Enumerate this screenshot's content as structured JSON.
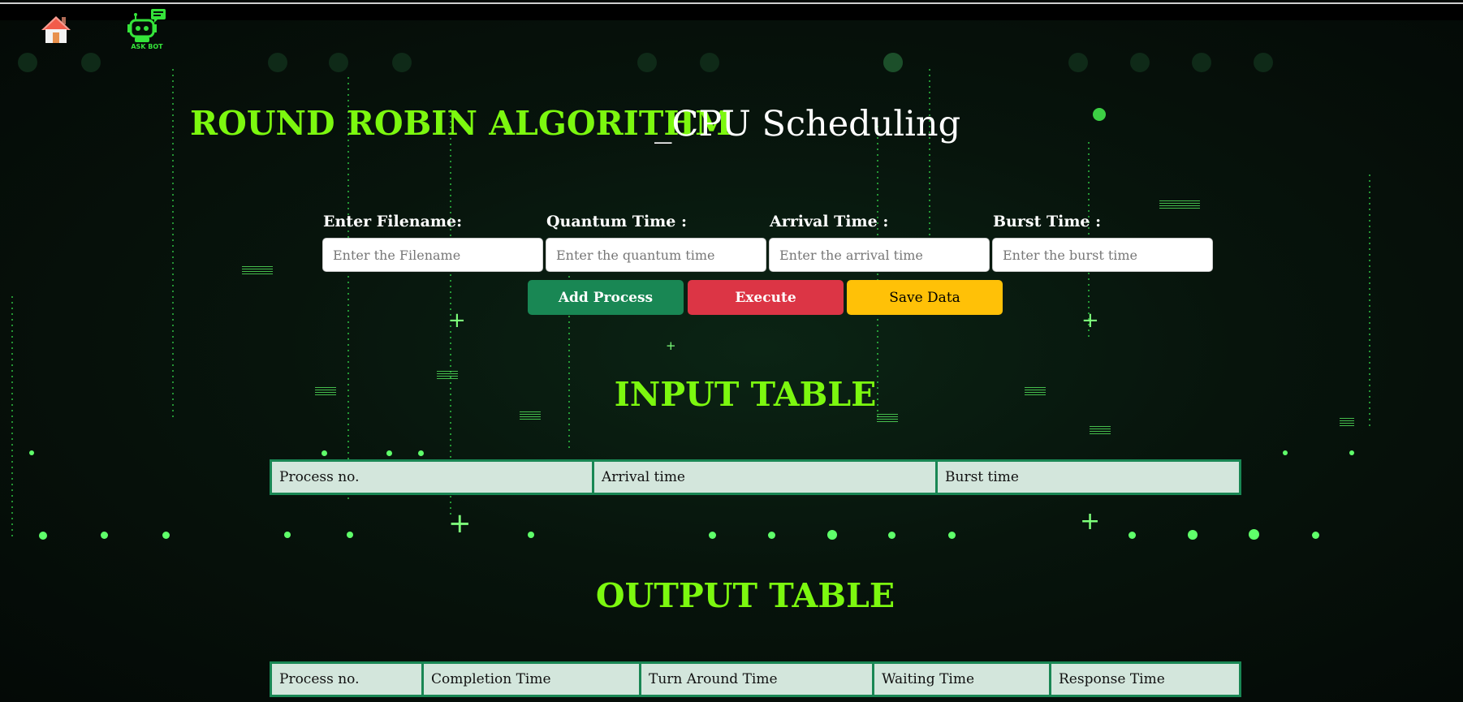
{
  "nav": {
    "home_icon": "home-icon",
    "bot_icon": "robot-chat-icon",
    "bot_label": "ASK BOT"
  },
  "header": {
    "title": "ROUND ROBIN ALGORITHM",
    "subtitle": "_CPU Scheduling"
  },
  "form": {
    "filename": {
      "label": "Enter Filename:",
      "placeholder": "Enter the Filename"
    },
    "quantum": {
      "label": "Quantum Time :",
      "placeholder": "Enter the quantum time"
    },
    "arrival": {
      "label": "Arrival Time :",
      "placeholder": "Enter the arrival time"
    },
    "burst": {
      "label": "Burst Time :",
      "placeholder": "Enter the burst time"
    }
  },
  "buttons": {
    "add": "Add Process",
    "execute": "Execute",
    "save": "Save Data"
  },
  "input_table": {
    "title": "INPUT TABLE",
    "headers": [
      "Process no.",
      "Arrival time",
      "Burst time"
    ]
  },
  "output_table": {
    "title": "OUTPUT TABLE",
    "headers": [
      "Process no.",
      "Completion Time",
      "Turn Around Time",
      "Waiting Time",
      "Response Time"
    ]
  },
  "colors": {
    "accent": "#7cf80f",
    "add": "#198754",
    "execute": "#dc3545",
    "save": "#ffc107",
    "table_bg": "#d3e6dc"
  }
}
